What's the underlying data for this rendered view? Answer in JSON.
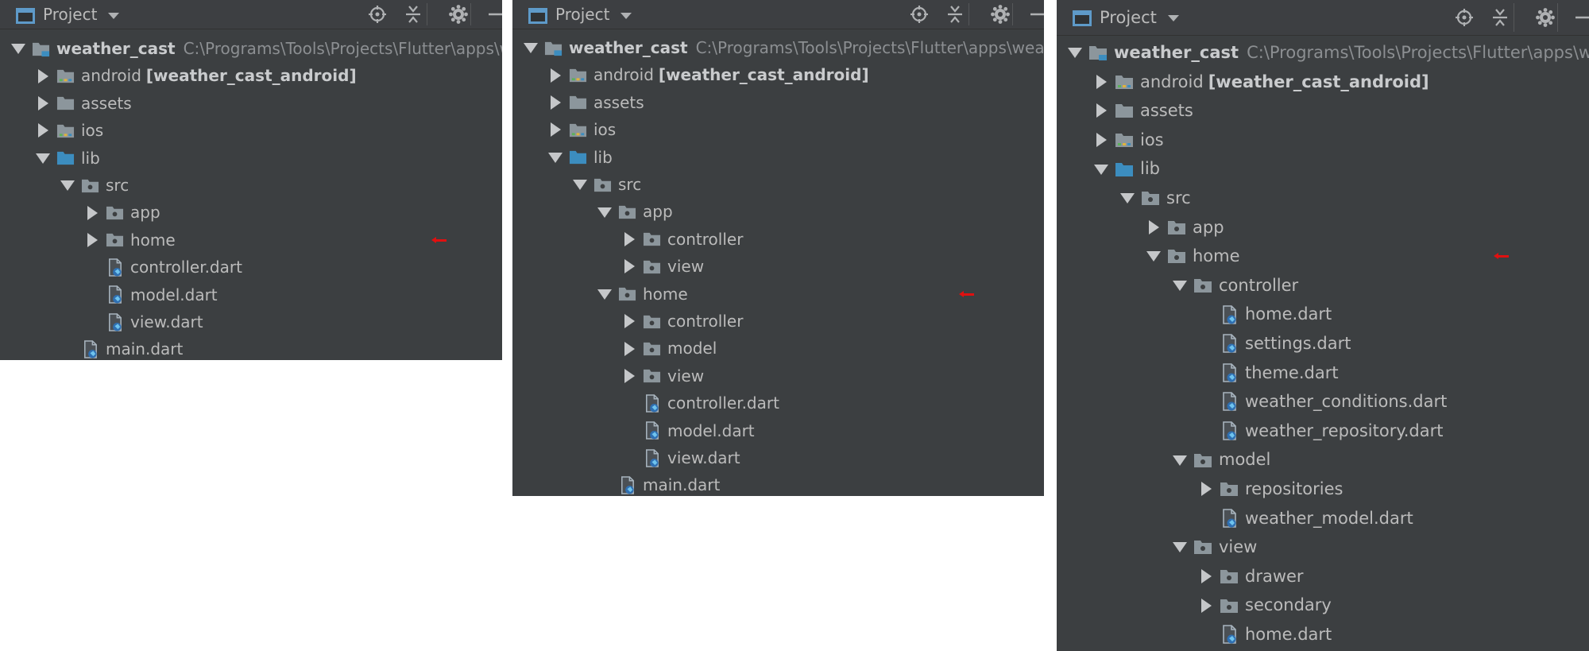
{
  "colors": {
    "panel_bg": "#3c3f41",
    "text": "#bbbbbb",
    "path_text": "#8c8f92",
    "folder": "#8c969c",
    "source_folder": "#3c8dbf",
    "dart_file": "#8ca0b0",
    "marker": "#e01010"
  },
  "panels": [
    {
      "toolbar": {
        "title": "Project"
      },
      "rows": [
        {
          "depth": 0,
          "arrow": "expanded",
          "icon": "module-folder-icon",
          "name": "weather_cast",
          "path": "C:\\Programs\\Tools\\Projects\\Flutter\\apps\\weather_cast"
        },
        {
          "depth": 1,
          "arrow": "collapsed",
          "icon": "android-module-folder-icon",
          "name": "android",
          "tag": "[weather_cast_android]"
        },
        {
          "depth": 1,
          "arrow": "collapsed",
          "icon": "folder-icon",
          "name": "assets"
        },
        {
          "depth": 1,
          "arrow": "collapsed",
          "icon": "android-module-folder-icon",
          "name": "ios"
        },
        {
          "depth": 1,
          "arrow": "expanded",
          "icon": "source-folder-icon",
          "name": "lib"
        },
        {
          "depth": 2,
          "arrow": "expanded",
          "icon": "package-folder-icon",
          "name": "src"
        },
        {
          "depth": 3,
          "arrow": "collapsed",
          "icon": "package-folder-icon",
          "name": "app"
        },
        {
          "depth": 3,
          "arrow": "collapsed",
          "icon": "package-folder-icon",
          "name": "home",
          "marker": true
        },
        {
          "depth": 3,
          "arrow": "none",
          "icon": "dart-file-icon",
          "name": "controller.dart"
        },
        {
          "depth": 3,
          "arrow": "none",
          "icon": "dart-file-icon",
          "name": "model.dart"
        },
        {
          "depth": 3,
          "arrow": "none",
          "icon": "dart-file-icon",
          "name": "view.dart"
        },
        {
          "depth": 2,
          "arrow": "none",
          "icon": "dart-file-icon",
          "name": "main.dart"
        }
      ]
    },
    {
      "toolbar": {
        "title": "Project"
      },
      "rows": [
        {
          "depth": 0,
          "arrow": "expanded",
          "icon": "module-folder-icon",
          "name": "weather_cast",
          "path": "C:\\Programs\\Tools\\Projects\\Flutter\\apps\\weather_cast"
        },
        {
          "depth": 1,
          "arrow": "collapsed",
          "icon": "android-module-folder-icon",
          "name": "android",
          "tag": "[weather_cast_android]"
        },
        {
          "depth": 1,
          "arrow": "collapsed",
          "icon": "folder-icon",
          "name": "assets"
        },
        {
          "depth": 1,
          "arrow": "collapsed",
          "icon": "android-module-folder-icon",
          "name": "ios"
        },
        {
          "depth": 1,
          "arrow": "expanded",
          "icon": "source-folder-icon",
          "name": "lib"
        },
        {
          "depth": 2,
          "arrow": "expanded",
          "icon": "package-folder-icon",
          "name": "src"
        },
        {
          "depth": 3,
          "arrow": "expanded",
          "icon": "package-folder-icon",
          "name": "app"
        },
        {
          "depth": 4,
          "arrow": "collapsed",
          "icon": "package-folder-icon",
          "name": "controller"
        },
        {
          "depth": 4,
          "arrow": "collapsed",
          "icon": "package-folder-icon",
          "name": "view"
        },
        {
          "depth": 3,
          "arrow": "expanded",
          "icon": "package-folder-icon",
          "name": "home",
          "marker": true
        },
        {
          "depth": 4,
          "arrow": "collapsed",
          "icon": "package-folder-icon",
          "name": "controller"
        },
        {
          "depth": 4,
          "arrow": "collapsed",
          "icon": "package-folder-icon",
          "name": "model"
        },
        {
          "depth": 4,
          "arrow": "collapsed",
          "icon": "package-folder-icon",
          "name": "view"
        },
        {
          "depth": 4,
          "arrow": "none",
          "icon": "dart-file-icon",
          "name": "controller.dart"
        },
        {
          "depth": 4,
          "arrow": "none",
          "icon": "dart-file-icon",
          "name": "model.dart"
        },
        {
          "depth": 4,
          "arrow": "none",
          "icon": "dart-file-icon",
          "name": "view.dart"
        },
        {
          "depth": 3,
          "arrow": "none",
          "icon": "dart-file-icon",
          "name": "main.dart"
        }
      ]
    },
    {
      "toolbar": {
        "title": "Project"
      },
      "rows": [
        {
          "depth": 0,
          "arrow": "expanded",
          "icon": "module-folder-icon",
          "name": "weather_cast",
          "path": "C:\\Programs\\Tools\\Projects\\Flutter\\apps\\weather_cast"
        },
        {
          "depth": 1,
          "arrow": "collapsed",
          "icon": "android-module-folder-icon",
          "name": "android",
          "tag": "[weather_cast_android]"
        },
        {
          "depth": 1,
          "arrow": "collapsed",
          "icon": "folder-icon",
          "name": "assets"
        },
        {
          "depth": 1,
          "arrow": "collapsed",
          "icon": "android-module-folder-icon",
          "name": "ios"
        },
        {
          "depth": 1,
          "arrow": "expanded",
          "icon": "source-folder-icon",
          "name": "lib"
        },
        {
          "depth": 2,
          "arrow": "expanded",
          "icon": "package-folder-icon",
          "name": "src"
        },
        {
          "depth": 3,
          "arrow": "collapsed",
          "icon": "package-folder-icon",
          "name": "app"
        },
        {
          "depth": 3,
          "arrow": "expanded",
          "icon": "package-folder-icon",
          "name": "home",
          "marker": true
        },
        {
          "depth": 4,
          "arrow": "expanded",
          "icon": "package-folder-icon",
          "name": "controller"
        },
        {
          "depth": 5,
          "arrow": "none",
          "icon": "dart-file-icon",
          "name": "home.dart"
        },
        {
          "depth": 5,
          "arrow": "none",
          "icon": "dart-file-icon",
          "name": "settings.dart"
        },
        {
          "depth": 5,
          "arrow": "none",
          "icon": "dart-file-icon",
          "name": "theme.dart"
        },
        {
          "depth": 5,
          "arrow": "none",
          "icon": "dart-file-icon",
          "name": "weather_conditions.dart"
        },
        {
          "depth": 5,
          "arrow": "none",
          "icon": "dart-file-icon",
          "name": "weather_repository.dart"
        },
        {
          "depth": 4,
          "arrow": "expanded",
          "icon": "package-folder-icon",
          "name": "model"
        },
        {
          "depth": 5,
          "arrow": "collapsed",
          "icon": "package-folder-icon",
          "name": "repositories"
        },
        {
          "depth": 5,
          "arrow": "none",
          "icon": "dart-file-icon",
          "name": "weather_model.dart"
        },
        {
          "depth": 4,
          "arrow": "expanded",
          "icon": "package-folder-icon",
          "name": "view"
        },
        {
          "depth": 5,
          "arrow": "collapsed",
          "icon": "package-folder-icon",
          "name": "drawer"
        },
        {
          "depth": 5,
          "arrow": "collapsed",
          "icon": "package-folder-icon",
          "name": "secondary"
        },
        {
          "depth": 5,
          "arrow": "none",
          "icon": "dart-file-icon",
          "name": "home.dart"
        }
      ]
    }
  ]
}
